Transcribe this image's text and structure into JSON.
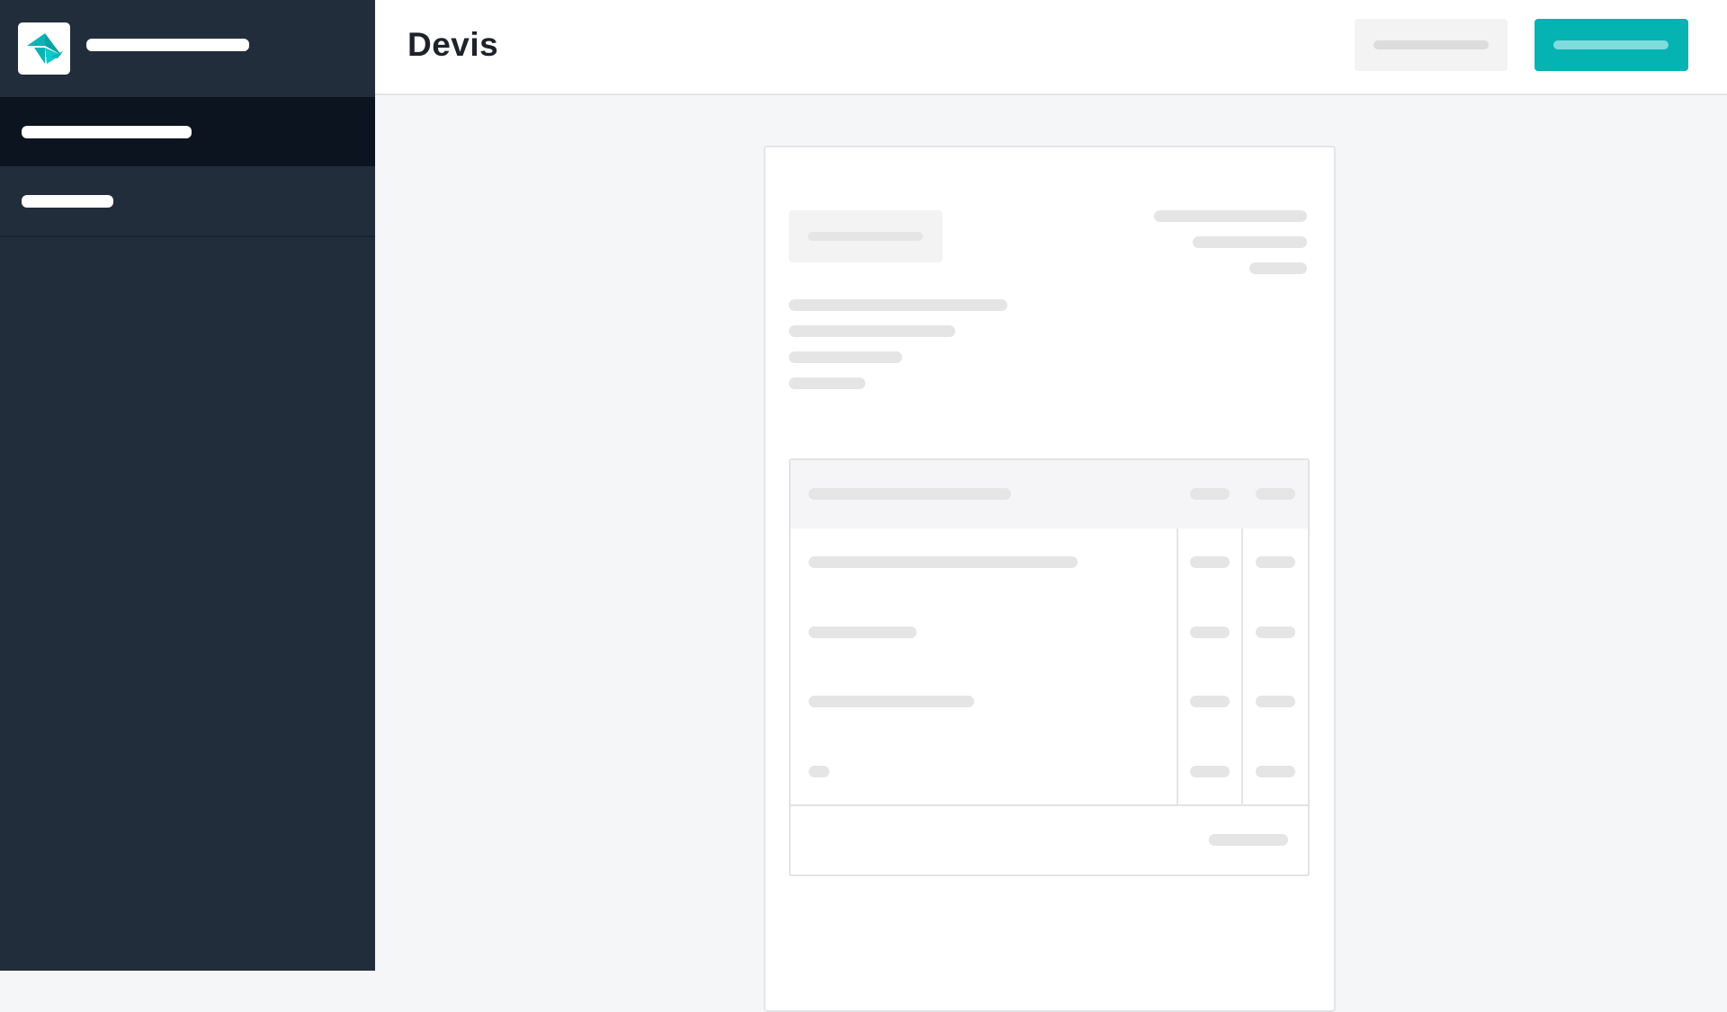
{
  "app": {
    "page_title": "Devis",
    "colors": {
      "sidebar_bg": "#212d3b",
      "sidebar_active_bg": "#0c1420",
      "accent": "#05b3b3",
      "placeholder": "#e5e5e5"
    }
  },
  "sidebar": {
    "logo_icon": "paper-plane-icon",
    "items": [
      {
        "id": "item-1",
        "active": true
      },
      {
        "id": "item-2",
        "active": false
      }
    ]
  },
  "header": {
    "secondary_button": {
      "style": "secondary"
    },
    "primary_button": {
      "style": "primary"
    }
  },
  "document": {
    "table": {
      "row_count": 4,
      "column_count": 3
    }
  }
}
